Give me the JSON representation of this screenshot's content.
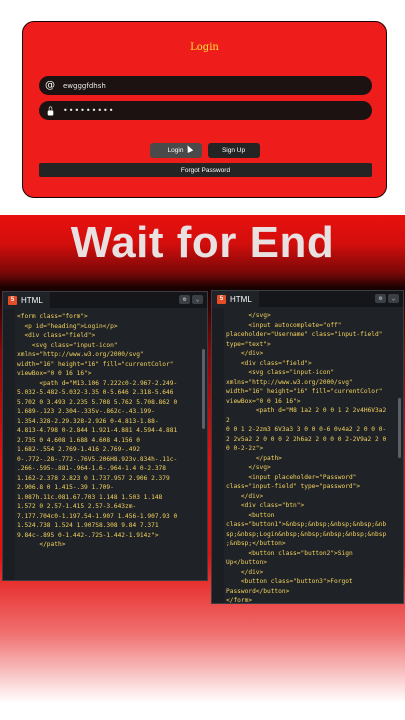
{
  "login": {
    "heading": "Login",
    "username_value": "ewgggfdhsh",
    "password_value": "•••••••••",
    "login_button": "Login",
    "signup_button": "Sign Up",
    "forgot_button": "Forgot Password",
    "colors": {
      "card": "#ef1c1c",
      "field": "#1c1212",
      "heading": "#ffe43a"
    }
  },
  "banner": {
    "text": "Wait for End"
  },
  "left_panel": {
    "tab": "HTML",
    "lines": [
      "<form class=\"form\">",
      "  <p id=\"heading\">Login</p>",
      "  <div class=\"field\">",
      "    <svg class=\"input-icon\"",
      "xmlns=\"http://www.w3.org/2000/svg\"",
      "width=\"16\" height=\"16\" fill=\"currentColor\"",
      "viewBox=\"0 0 16 16\">",
      "      <path d=\"M13.106 7.222c0-2.967-2.249-",
      "5.032-5.482-5.032-3.35 0-5.646 2.318-5.646",
      "5.702 0 3.493 2.235 5.708 5.762 5.708.862 0",
      "1.689-.123 2.304-.335v-.862c-.43.199-",
      "1.354.328-2.29.328-2.926 0-4.813-1.88-",
      "4.813-4.798 0-2.844 1.921-4.881 4.594-4.881",
      "2.735 0 4.608 1.688 4.608 4.156 0",
      "1.682-.554 2.769-1.416 2.769-.492",
      "0-.772-.28-.772-.76V5.206H8.923v.834h-.11c-",
      ".266-.595-.881-.964-1.6-.964-1.4 0-2.378",
      "1.162-2.378 2.823 0 1.737.957 2.906 2.379",
      "2.906.8 0 1.415-.39 1.709-",
      "1.087h.11c.081.67.703 1.148 1.503 1.148",
      "1.572 0 2.57-1.415 2.57-3.643zm-",
      "7.177.704c0-1.197.54-1.907 1.456-1.907.93 0",
      "1.524.738 1.524 1.907S8.308 9.84 7.371",
      "9.84c-.895 0-1.442-.725-1.442-1.914z\">",
      "      </path>"
    ]
  },
  "right_panel": {
    "tab": "HTML",
    "lines": [
      "      </svg>",
      "      <input autocomplete=\"off\"",
      "placeholder=\"Username\" class=\"input-field\"",
      "type=\"text\">",
      "    </div>",
      "    <div class=\"field\">",
      "      <svg class=\"input-icon\"",
      "xmlns=\"http://www.w3.org/2000/svg\"",
      "width=\"16\" height=\"16\" fill=\"currentColor\"",
      "viewBox=\"0 0 16 16\">",
      "        <path d=\"M8 1a2 2 0 0 1 2 2v4H6V3a2 2",
      "0 0 1 2-2zm3 6V3a3 3 0 0 0-6 0v4a2 2 0 0 0-",
      "2 2v5a2 2 0 0 0 2 2h6a2 2 0 0 0 2-2V9a2 2 0",
      "0 0-2-2z\">",
      "        </path>",
      "      </svg>",
      "      <input placeholder=\"Password\"",
      "class=\"input-field\" type=\"password\">",
      "    </div>",
      "    <div class=\"btn\">",
      "      <button",
      "class=\"button1\">&nbsp;&nbsp;&nbsp;&nbsp;&nb",
      "sp;&nbsp;Login&nbsp;&nbsp;&nbsp;&nbsp;&nbsp",
      ";&nbsp;</button>",
      "      <button class=\"button2\">Sign",
      "Up</button>",
      "    </div>",
      "    <button class=\"button3\">Forgot",
      "Password</button>",
      "</form>"
    ]
  }
}
